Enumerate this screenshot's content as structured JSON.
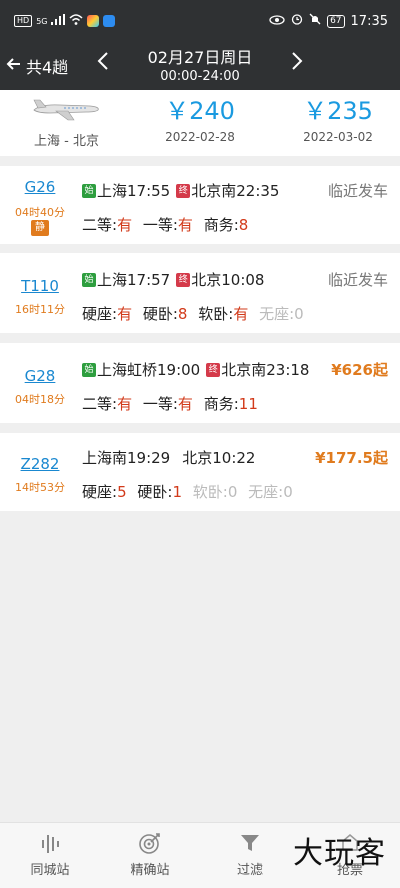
{
  "status": {
    "network": "HD",
    "signal": "5G",
    "battery": "67",
    "time": "17:35"
  },
  "nav": {
    "back_label": "共4趟",
    "date": "02月27日周日",
    "time_range": "00:00-24:00"
  },
  "price_bar": {
    "route": "上海 - 北京",
    "options": [
      {
        "price": "￥240",
        "date": "2022-02-28"
      },
      {
        "price": "￥235",
        "date": "2022-03-02"
      }
    ]
  },
  "trains": [
    {
      "code": "G26",
      "duration": "04时40分",
      "quiet": "静",
      "start_tag": "始",
      "from": "上海17:55",
      "end_tag": "终",
      "to": "北京南22:35",
      "right": "临近发车",
      "seats": [
        {
          "label": "二等:",
          "value": "有"
        },
        {
          "label": "一等:",
          "value": "有"
        },
        {
          "label": "商务:",
          "value": "8"
        }
      ]
    },
    {
      "code": "T110",
      "duration": "16时11分",
      "start_tag": "始",
      "from": "上海17:57",
      "end_tag": "终",
      "to": "北京10:08",
      "right": "临近发车",
      "seats": [
        {
          "label": "硬座:",
          "value": "有"
        },
        {
          "label": "硬卧:",
          "value": "8"
        },
        {
          "label": "软卧:",
          "value": "有"
        },
        {
          "label": "无座:",
          "value": "0",
          "disabled": true
        }
      ]
    },
    {
      "code": "G28",
      "duration": "04时18分",
      "start_tag": "始",
      "from": "上海虹桥19:00",
      "end_tag": "终",
      "to": "北京南23:18",
      "right": "¥626起",
      "seats": [
        {
          "label": "二等:",
          "value": "有"
        },
        {
          "label": "一等:",
          "value": "有"
        },
        {
          "label": "商务:",
          "value": "11"
        }
      ]
    },
    {
      "code": "Z282",
      "duration": "14时53分",
      "from": "上海南19:29",
      "to": "北京10:22",
      "right": "¥177.5起",
      "seats": [
        {
          "label": "硬座:",
          "value": "5"
        },
        {
          "label": "硬卧:",
          "value": "1"
        },
        {
          "label": "软卧:",
          "value": "0",
          "disabled": true
        },
        {
          "label": "无座:",
          "value": "0",
          "disabled": true
        }
      ]
    }
  ],
  "tabs": {
    "t1": "同城站",
    "t2": "精确站",
    "t3": "过滤",
    "t4": "抢票"
  },
  "watermark": "大玩客",
  "colors": {
    "accent": "#1a9ae0",
    "orange": "#e07b1e",
    "red": "#d23a1a",
    "header": "#2f3133"
  }
}
